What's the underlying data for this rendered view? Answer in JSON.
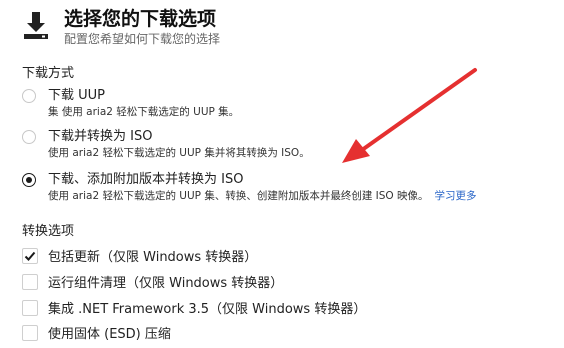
{
  "header": {
    "icon": "download-icon",
    "title": "选择您的下载选项",
    "subtitle": "配置您希望如何下载您的选择"
  },
  "download_method": {
    "label": "下载方式",
    "options": [
      {
        "label": "下载 UUP",
        "desc": "集 使用 aria2 轻松下载选定的 UUP 集。",
        "checked": false
      },
      {
        "label": "下载并转换为 ISO",
        "desc": "使用 aria2 轻松下载选定的 UUP 集并将其转换为 ISO。",
        "checked": false
      },
      {
        "label": "下载、添加附加版本并转换为 ISO",
        "desc": "使用 aria2 轻松下载选定的 UUP 集、转换、创建附加版本并最终创建 ISO 映像。",
        "link": "学习更多",
        "checked": true
      }
    ]
  },
  "conversion_options": {
    "label": "转换选项",
    "items": [
      {
        "label": "包括更新（仅限 Windows 转换器）",
        "checked": true
      },
      {
        "label": "运行组件清理（仅限 Windows 转换器）",
        "checked": false
      },
      {
        "label": "集成 .NET Framework 3.5（仅限 Windows 转换器）",
        "checked": false
      },
      {
        "label": "使用固体 (ESD) 压缩",
        "checked": false
      }
    ]
  },
  "colors": {
    "accent_link": "#2a66c8",
    "arrow": "#e53030"
  }
}
